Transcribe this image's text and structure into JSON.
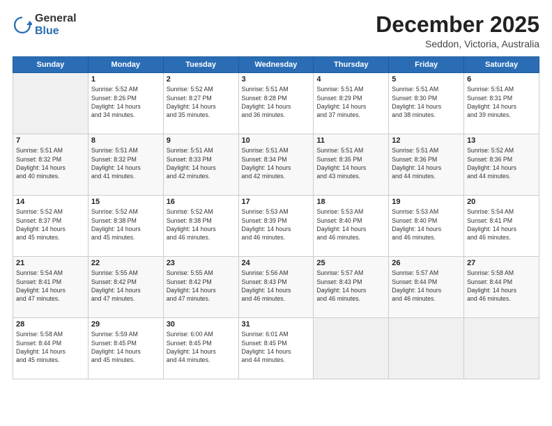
{
  "logo": {
    "general": "General",
    "blue": "Blue"
  },
  "header": {
    "month": "December 2025",
    "location": "Seddon, Victoria, Australia"
  },
  "days_of_week": [
    "Sunday",
    "Monday",
    "Tuesday",
    "Wednesday",
    "Thursday",
    "Friday",
    "Saturday"
  ],
  "weeks": [
    [
      {
        "day": "",
        "info": ""
      },
      {
        "day": "1",
        "info": "Sunrise: 5:52 AM\nSunset: 8:26 PM\nDaylight: 14 hours\nand 34 minutes."
      },
      {
        "day": "2",
        "info": "Sunrise: 5:52 AM\nSunset: 8:27 PM\nDaylight: 14 hours\nand 35 minutes."
      },
      {
        "day": "3",
        "info": "Sunrise: 5:51 AM\nSunset: 8:28 PM\nDaylight: 14 hours\nand 36 minutes."
      },
      {
        "day": "4",
        "info": "Sunrise: 5:51 AM\nSunset: 8:29 PM\nDaylight: 14 hours\nand 37 minutes."
      },
      {
        "day": "5",
        "info": "Sunrise: 5:51 AM\nSunset: 8:30 PM\nDaylight: 14 hours\nand 38 minutes."
      },
      {
        "day": "6",
        "info": "Sunrise: 5:51 AM\nSunset: 8:31 PM\nDaylight: 14 hours\nand 39 minutes."
      }
    ],
    [
      {
        "day": "7",
        "info": "Sunrise: 5:51 AM\nSunset: 8:32 PM\nDaylight: 14 hours\nand 40 minutes."
      },
      {
        "day": "8",
        "info": "Sunrise: 5:51 AM\nSunset: 8:32 PM\nDaylight: 14 hours\nand 41 minutes."
      },
      {
        "day": "9",
        "info": "Sunrise: 5:51 AM\nSunset: 8:33 PM\nDaylight: 14 hours\nand 42 minutes."
      },
      {
        "day": "10",
        "info": "Sunrise: 5:51 AM\nSunset: 8:34 PM\nDaylight: 14 hours\nand 42 minutes."
      },
      {
        "day": "11",
        "info": "Sunrise: 5:51 AM\nSunset: 8:35 PM\nDaylight: 14 hours\nand 43 minutes."
      },
      {
        "day": "12",
        "info": "Sunrise: 5:51 AM\nSunset: 8:36 PM\nDaylight: 14 hours\nand 44 minutes."
      },
      {
        "day": "13",
        "info": "Sunrise: 5:52 AM\nSunset: 8:36 PM\nDaylight: 14 hours\nand 44 minutes."
      }
    ],
    [
      {
        "day": "14",
        "info": "Sunrise: 5:52 AM\nSunset: 8:37 PM\nDaylight: 14 hours\nand 45 minutes."
      },
      {
        "day": "15",
        "info": "Sunrise: 5:52 AM\nSunset: 8:38 PM\nDaylight: 14 hours\nand 45 minutes."
      },
      {
        "day": "16",
        "info": "Sunrise: 5:52 AM\nSunset: 8:38 PM\nDaylight: 14 hours\nand 46 minutes."
      },
      {
        "day": "17",
        "info": "Sunrise: 5:53 AM\nSunset: 8:39 PM\nDaylight: 14 hours\nand 46 minutes."
      },
      {
        "day": "18",
        "info": "Sunrise: 5:53 AM\nSunset: 8:40 PM\nDaylight: 14 hours\nand 46 minutes."
      },
      {
        "day": "19",
        "info": "Sunrise: 5:53 AM\nSunset: 8:40 PM\nDaylight: 14 hours\nand 46 minutes."
      },
      {
        "day": "20",
        "info": "Sunrise: 5:54 AM\nSunset: 8:41 PM\nDaylight: 14 hours\nand 46 minutes."
      }
    ],
    [
      {
        "day": "21",
        "info": "Sunrise: 5:54 AM\nSunset: 8:41 PM\nDaylight: 14 hours\nand 47 minutes."
      },
      {
        "day": "22",
        "info": "Sunrise: 5:55 AM\nSunset: 8:42 PM\nDaylight: 14 hours\nand 47 minutes."
      },
      {
        "day": "23",
        "info": "Sunrise: 5:55 AM\nSunset: 8:42 PM\nDaylight: 14 hours\nand 47 minutes."
      },
      {
        "day": "24",
        "info": "Sunrise: 5:56 AM\nSunset: 8:43 PM\nDaylight: 14 hours\nand 46 minutes."
      },
      {
        "day": "25",
        "info": "Sunrise: 5:57 AM\nSunset: 8:43 PM\nDaylight: 14 hours\nand 46 minutes."
      },
      {
        "day": "26",
        "info": "Sunrise: 5:57 AM\nSunset: 8:44 PM\nDaylight: 14 hours\nand 46 minutes."
      },
      {
        "day": "27",
        "info": "Sunrise: 5:58 AM\nSunset: 8:44 PM\nDaylight: 14 hours\nand 46 minutes."
      }
    ],
    [
      {
        "day": "28",
        "info": "Sunrise: 5:58 AM\nSunset: 8:44 PM\nDaylight: 14 hours\nand 45 minutes."
      },
      {
        "day": "29",
        "info": "Sunrise: 5:59 AM\nSunset: 8:45 PM\nDaylight: 14 hours\nand 45 minutes."
      },
      {
        "day": "30",
        "info": "Sunrise: 6:00 AM\nSunset: 8:45 PM\nDaylight: 14 hours\nand 44 minutes."
      },
      {
        "day": "31",
        "info": "Sunrise: 6:01 AM\nSunset: 8:45 PM\nDaylight: 14 hours\nand 44 minutes."
      },
      {
        "day": "",
        "info": ""
      },
      {
        "day": "",
        "info": ""
      },
      {
        "day": "",
        "info": ""
      }
    ]
  ]
}
